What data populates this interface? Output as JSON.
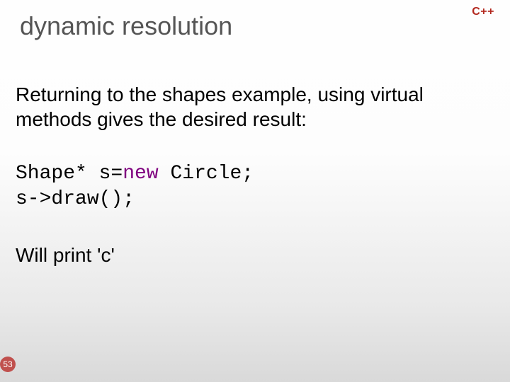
{
  "header": {
    "title": "dynamic resolution",
    "tag": "C++"
  },
  "content": {
    "intro": "Returning to the shapes example, using virtual methods gives the desired result:",
    "code": {
      "line1_pre": "Shape* s=",
      "line1_kw": "new",
      "line1_post": " Circle;",
      "line2": "s->draw();"
    },
    "outcome": "Will print 'c'"
  },
  "footer": {
    "page_number": "53"
  }
}
